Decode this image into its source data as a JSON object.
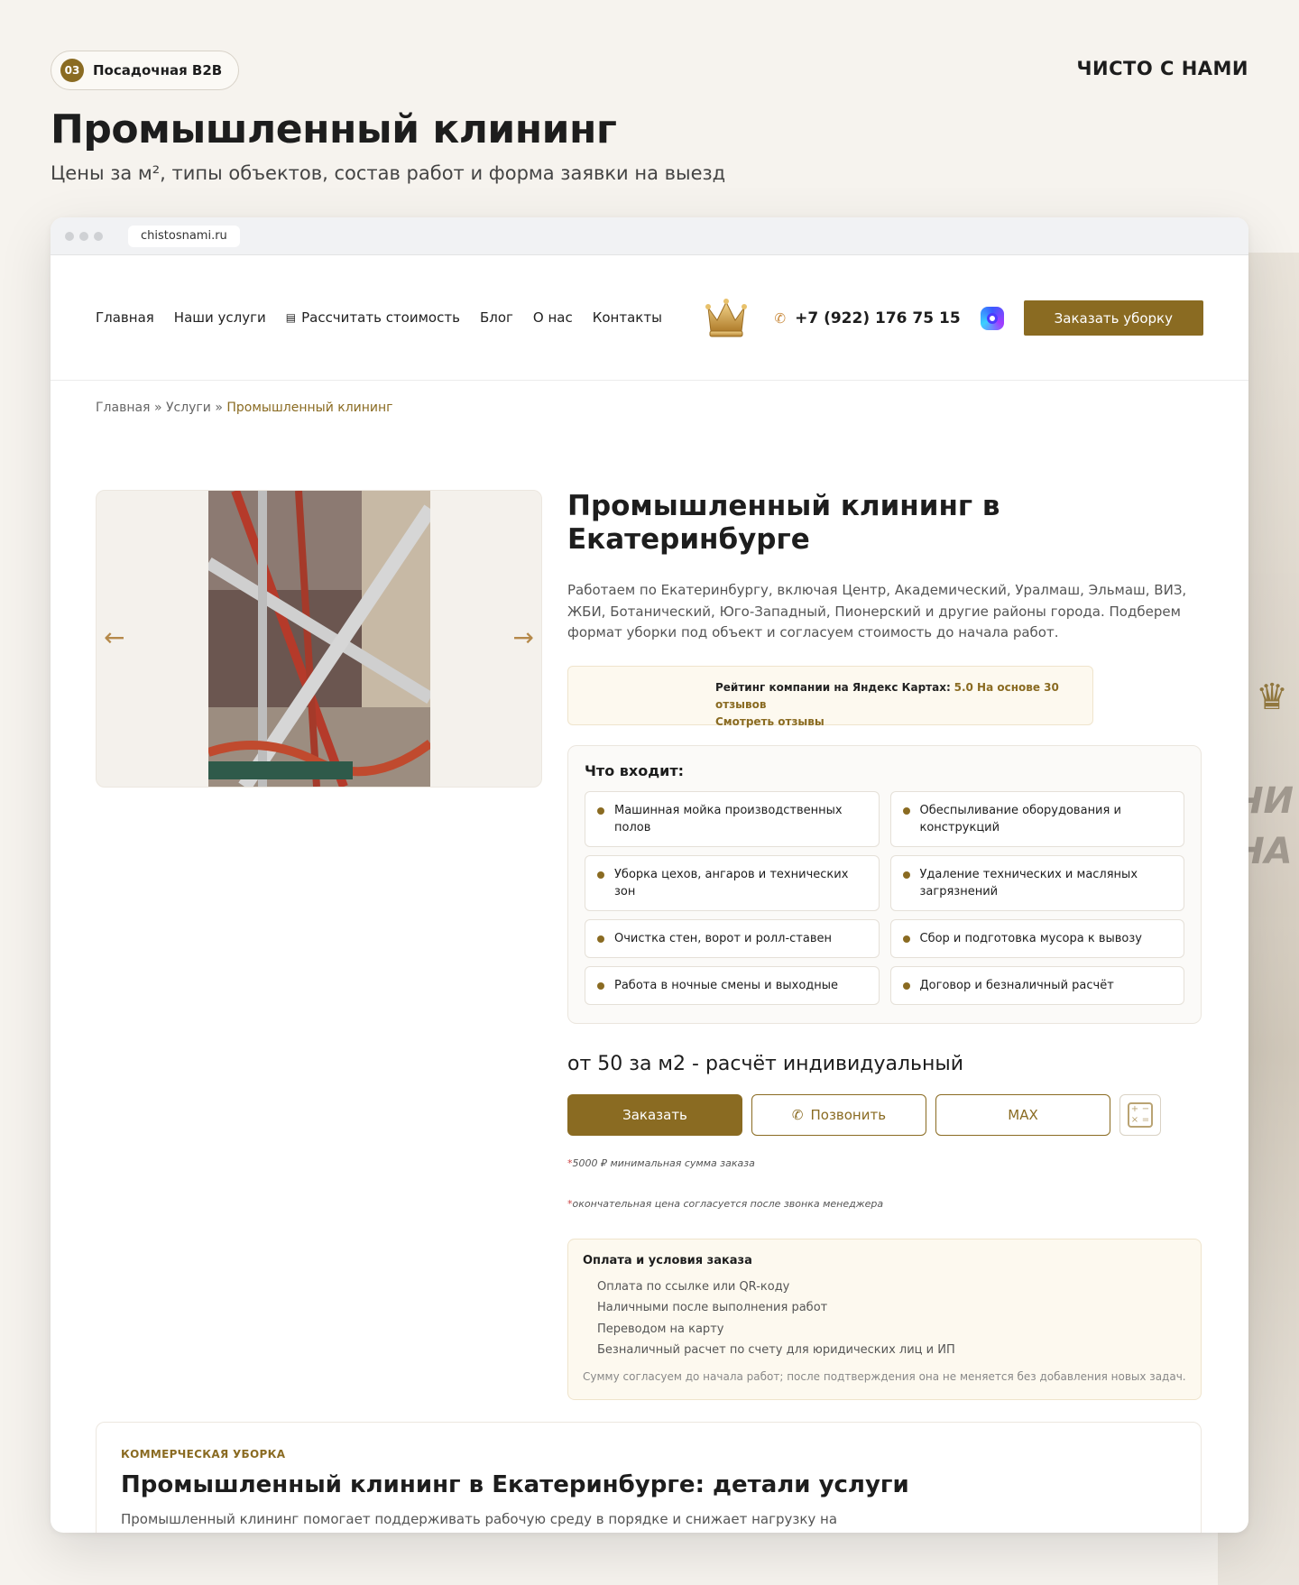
{
  "badge": {
    "number": "03",
    "label": "Посадочная B2B"
  },
  "brand": "ЧИСТО С НАМИ",
  "hero": {
    "title": "Промышленный клининг",
    "subtitle": "Цены за м², типы объектов, состав работ и форма заявки на выезд"
  },
  "browser": {
    "url": "chistosnami.ru"
  },
  "nav": {
    "links": [
      "Главная",
      "Наши услуги",
      "Рассчитать стоимость",
      "Блог",
      "О нас",
      "Контакты"
    ],
    "phone": "+7 (922) 176 75 15",
    "order_label": "Заказать уборку"
  },
  "breadcrumbs": {
    "home": "Главная",
    "sep": "»",
    "services": "Услуги",
    "current": "Промышленный клининг"
  },
  "service": {
    "title": "Промышленный клининг в Екатеринбурге",
    "description": "Работаем по Екатеринбургу, включая Центр, Академический, Уралмаш, Эльмаш, ВИЗ, ЖБИ, Ботанический, Юго-Западный, Пионерский и другие районы города. Подберем формат уборки под объект и согласуем стоимость до начала работ.",
    "rating_label": "Рейтинг компании на Яндекс Картах:",
    "rating_value": "5.0 На основе 30 отзывов",
    "rating_link": "Смотреть отзывы",
    "includes_title": "Что входит:",
    "includes": [
      "Машинная мойка производственных полов",
      "Обеспыливание оборудования и конструкций",
      "Уборка цехов, ангаров и технических зон",
      "Удаление технических и масляных загрязнений",
      "Очистка стен, ворот и ролл-ставен",
      "Сбор и подготовка мусора к вывозу",
      "Работа в ночные смены и выходные",
      "Договор и безналичный расчёт"
    ],
    "price": "от 50 за м2 - расчёт индивидуальный",
    "btn_order": "Заказать",
    "btn_call": "Позвонить",
    "btn_max": "MAX",
    "note_min": "5000 ₽ минимальная сумма заказа",
    "note_final": "окончательная цена согласуется после звонка менеджера",
    "payment_title": "Оплата и условия заказа",
    "payment_items": [
      "Оплата по ссылке или QR-коду",
      "Наличными после выполнения работ",
      "Переводом на карту",
      "Безналичный расчет по счету для юридических лиц и ИП"
    ],
    "payment_note": "Сумму согласуем до начала работ; после подтверждения она не меняется без добавления новых задач."
  },
  "details": {
    "eyebrow": "КОММЕРЧЕСКАЯ УБОРКА",
    "title": "Промышленный клининг в Екатеринбурге: детали услуги",
    "text": "Промышленный клининг помогает поддерживать рабочую среду в порядке и снижает нагрузку на"
  },
  "colors": {
    "accent": "#8a6b22",
    "background": "#f6f3ee"
  },
  "icons": [
    "phone-icon",
    "messenger-icon",
    "calculator-icon",
    "crown-logo-icon",
    "arrow-left-icon",
    "arrow-right-icon"
  ]
}
